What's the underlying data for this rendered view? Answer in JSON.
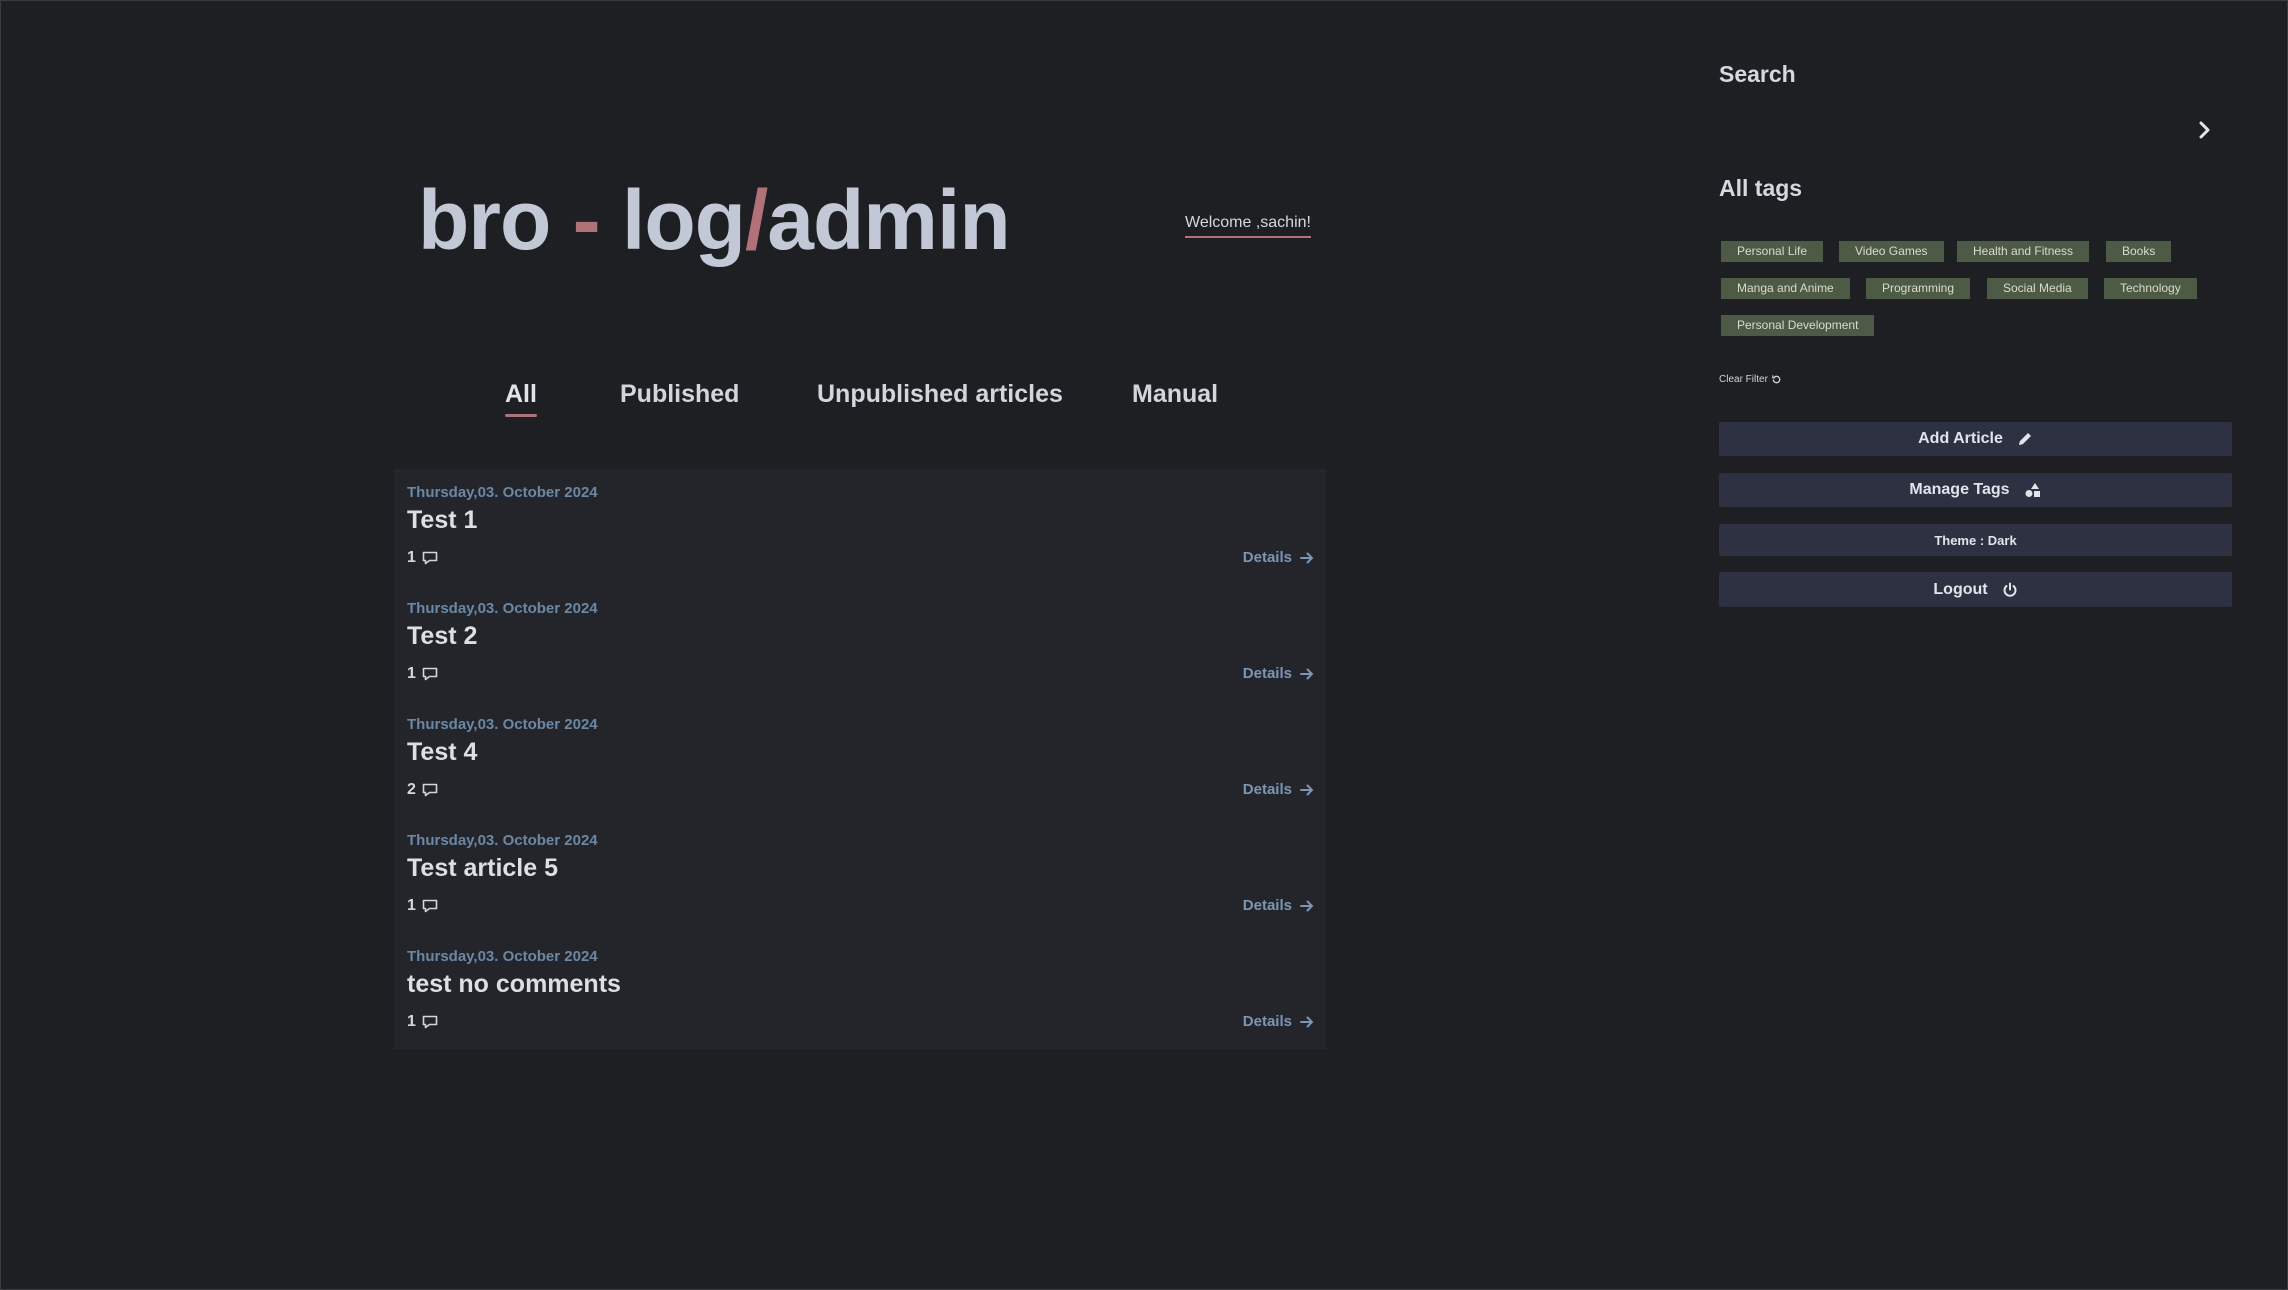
{
  "header": {
    "logo_part1": "bro ",
    "logo_dash": "-",
    "logo_part2": " log",
    "logo_slash": "/",
    "logo_part3": "admin",
    "welcome": "Welcome ,sachin!"
  },
  "tabs": [
    {
      "label": "All",
      "active": true
    },
    {
      "label": "Published"
    },
    {
      "label": "Unpublished articles"
    },
    {
      "label": "Manual"
    }
  ],
  "articles": [
    {
      "date": "Thursday,03. October 2024",
      "title": "Test 1",
      "comments": "1",
      "details": "Details"
    },
    {
      "date": "Thursday,03. October 2024",
      "title": "Test 2",
      "comments": "1",
      "details": "Details"
    },
    {
      "date": "Thursday,03. October 2024",
      "title": "Test 4",
      "comments": "2",
      "details": "Details"
    },
    {
      "date": "Thursday,03. October 2024",
      "title": "Test article 5",
      "comments": "1",
      "details": "Details"
    },
    {
      "date": "Thursday,03. October 2024",
      "title": "test no comments",
      "comments": "1",
      "details": "Details"
    }
  ],
  "sidebar": {
    "search_heading": "Search",
    "search_arrow_icon": "chevron-right-icon",
    "tags_heading": "All tags",
    "tags": [
      "Personal Life",
      "Video Games",
      "Health and Fitness",
      "Books",
      "Manga and Anime",
      "Programming",
      "Social Media",
      "Technology",
      "Personal Development"
    ],
    "clear_filter": "Clear Filter",
    "buttons": {
      "add_article": "Add Article",
      "manage_tags": "Manage Tags",
      "theme": "Theme : Dark",
      "logout": "Logout"
    }
  },
  "colors": {
    "background": "#1e1f22",
    "accent": "#b07179",
    "card": "#24252a",
    "tag": "#4d5a45",
    "button": "#2d3142",
    "date": "#6b87a6"
  }
}
